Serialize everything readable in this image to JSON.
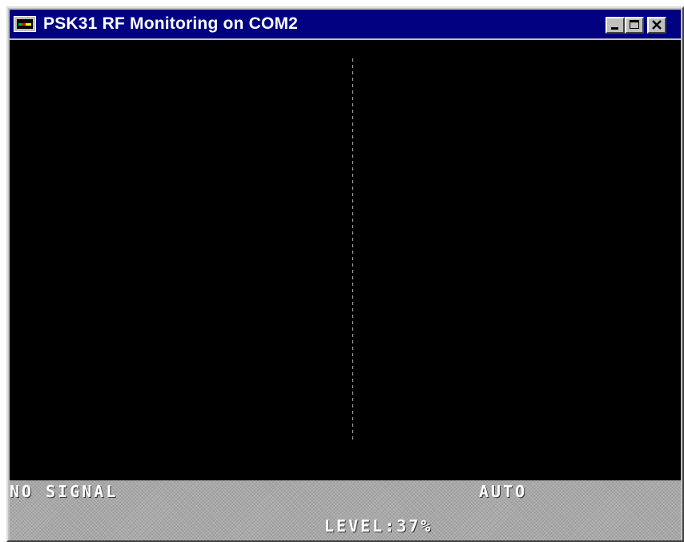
{
  "window": {
    "title": "PSK31 RF Monitoring on COM2",
    "icon": "psk31-app-icon"
  },
  "title_buttons": {
    "minimize_icon": "minimize-icon",
    "maximize_icon": "maximize-icon",
    "close_icon": "close-icon"
  },
  "status": {
    "signal": "NO SIGNAL",
    "mode": "AUTO",
    "level": "LEVEL:37%"
  },
  "colors": {
    "titlebar": "#000080",
    "display_background": "#000000",
    "center_line": "#c8c8c8",
    "status_text": "#ffffff",
    "status_background": "#a8a8a8"
  }
}
